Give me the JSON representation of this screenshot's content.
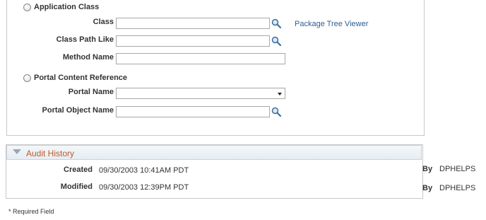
{
  "criteria": {
    "app_class_radio_label": "Application Class",
    "class_label": "Class",
    "class_value": "",
    "class_path_label": "Class Path Like",
    "class_path_value": "",
    "method_label": "Method Name",
    "method_value": "",
    "package_tree_link": "Package Tree Viewer",
    "portal_ref_radio_label": "Portal Content Reference",
    "portal_name_label": "Portal Name",
    "portal_name_value": "",
    "portal_object_label": "Portal Object Name",
    "portal_object_value": ""
  },
  "audit": {
    "title": "Audit History",
    "created_label": "Created",
    "created_value": "09/30/2003 10:41AM PDT",
    "created_by_label": "By",
    "created_by_value": "DPHELPS",
    "modified_label": "Modified",
    "modified_value": "09/30/2003 12:39PM PDT",
    "modified_by_label": "By",
    "modified_by_value": "DPHELPS"
  },
  "footer": {
    "required_note": "* Required Field"
  },
  "colors": {
    "link": "#2f5f8f",
    "section_title": "#c0582a",
    "border": "#c8c8c8"
  },
  "icons": {
    "lookup": "magnifier-icon",
    "expand": "triangle-down-icon",
    "dropdown": "chevron-down-icon"
  }
}
